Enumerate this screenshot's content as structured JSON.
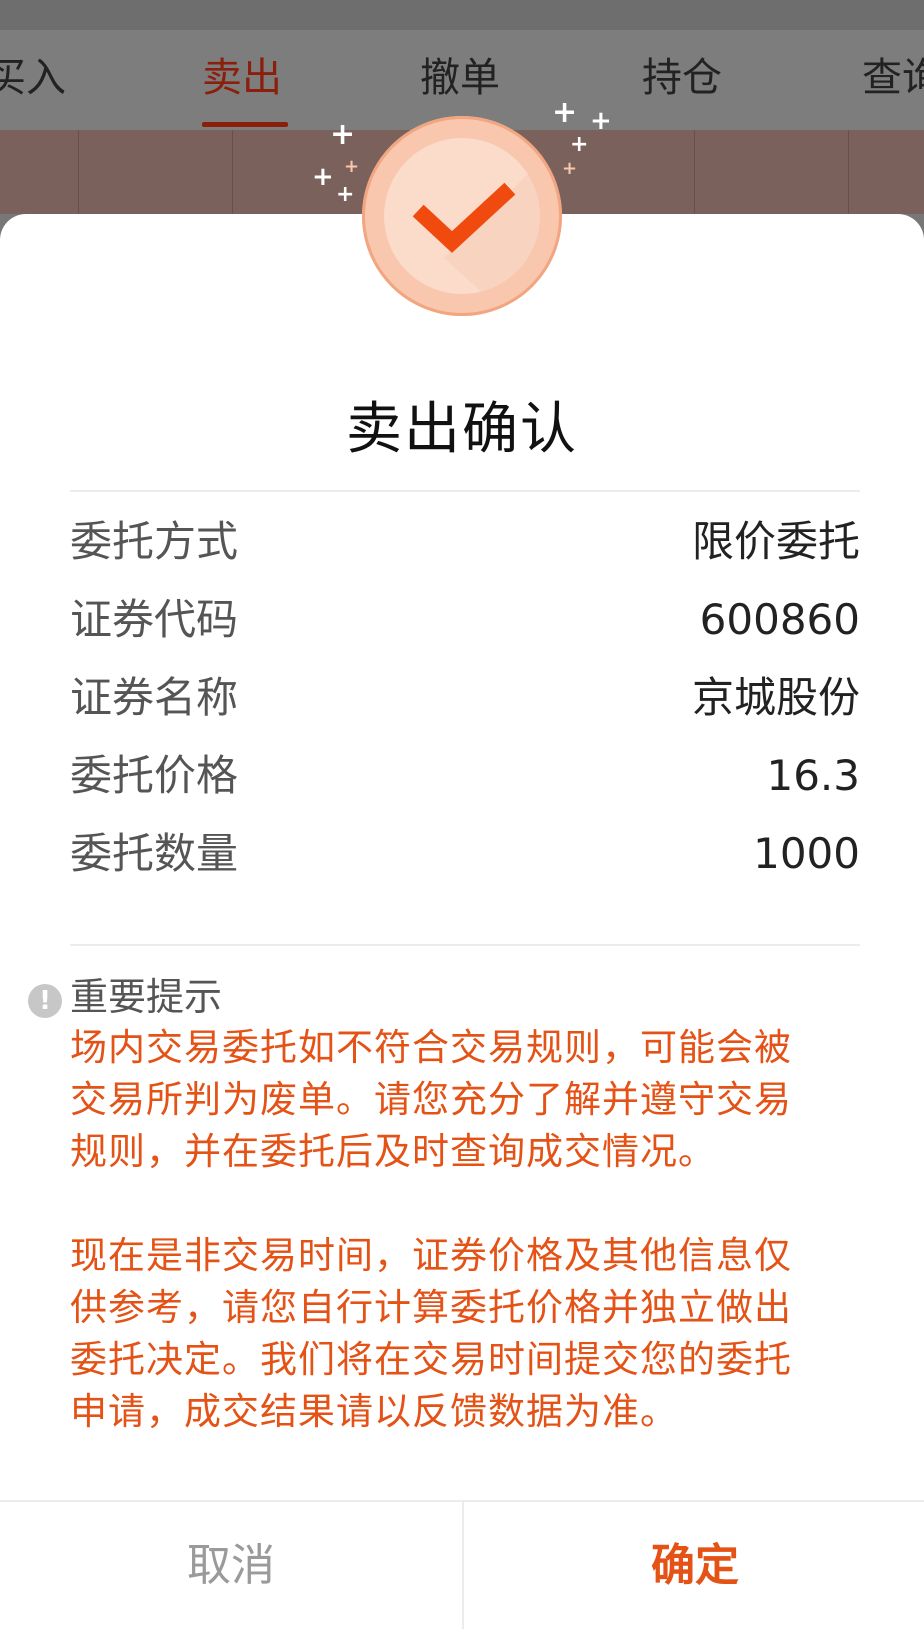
{
  "background": {
    "tabs": [
      "买入",
      "卖出",
      "撤单",
      "持仓",
      "查询"
    ],
    "active_tab": "卖出"
  },
  "dialog": {
    "badge_icon": "check-icon",
    "title": "卖出确认",
    "rows": [
      {
        "label": "委托方式",
        "value": "限价委托"
      },
      {
        "label": "证券代码",
        "value": "600860"
      },
      {
        "label": "证券名称",
        "value": "京城股份"
      },
      {
        "label": "委托价格",
        "value": "16.3"
      },
      {
        "label": "委托数量",
        "value": "1000"
      }
    ],
    "notice": {
      "icon": "info-icon",
      "title": "重要提示",
      "paragraphs": [
        [
          "场内交易委托如不符合交易规则，可能会被",
          "交易所判为废单。请您充分了解并遵守交易",
          "规则，并在委托后及时查询成交情况。"
        ],
        [
          "现在是非交易时间，证券价格及其他信息仅",
          "供参考，请您自行计算委托价格并独立做出",
          "委托决定。我们将在交易时间提交您的委托",
          "申请，成交结果请以反馈数据为准。"
        ]
      ]
    },
    "buttons": {
      "cancel": "取消",
      "confirm": "确定"
    }
  },
  "colors": {
    "accent": "#e45216",
    "check": "#f04a0f",
    "badge": "#f8c7ad"
  }
}
